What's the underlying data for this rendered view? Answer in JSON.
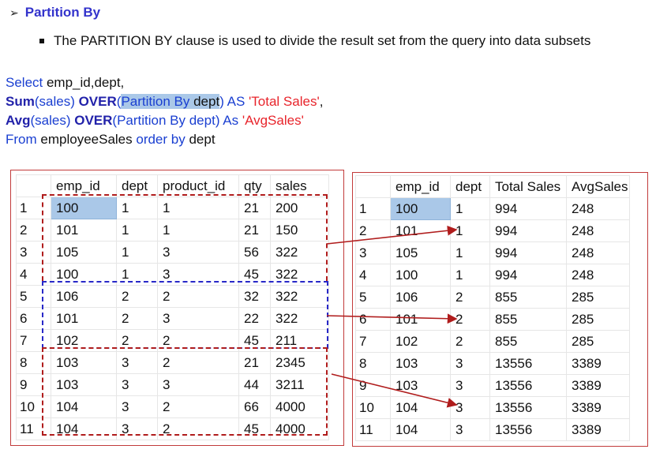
{
  "heading": {
    "arrow": "➢",
    "title": "Partition By"
  },
  "bullet": {
    "text": "The PARTITION BY clause is used to divide the result set from the query into data subsets"
  },
  "sql": {
    "line1_kw": "Select",
    "line1_rest": " emp_id,dept,",
    "line2_fn": "Sum",
    "line2_a": "(sales) ",
    "line2_over": "OVER",
    "line2_paren": "(",
    "line2_hl": "Partition By",
    "line2_dept": " dept",
    "line2_b": ") AS ",
    "line2_str": "'Total Sales'",
    "line2_c": ",",
    "line3_fn": "Avg",
    "line3_a": "(sales) ",
    "line3_over": "OVER",
    "line3_b": "(Partition By dept) As ",
    "line3_str": "'AvgSales'",
    "line4_kw": "From",
    "line4_a": " employeeSales ",
    "line4_kw2": "order by",
    "line4_b": " dept"
  },
  "left_table": {
    "headers": [
      "",
      "emp_id",
      "dept",
      "product_id",
      "qty",
      "sales"
    ],
    "rows": [
      [
        "1",
        "100",
        "1",
        "1",
        "21",
        "200"
      ],
      [
        "2",
        "101",
        "1",
        "1",
        "21",
        "150"
      ],
      [
        "3",
        "105",
        "1",
        "3",
        "56",
        "322"
      ],
      [
        "4",
        "100",
        "1",
        "3",
        "45",
        "322"
      ],
      [
        "5",
        "106",
        "2",
        "2",
        "32",
        "322"
      ],
      [
        "6",
        "101",
        "2",
        "3",
        "22",
        "322"
      ],
      [
        "7",
        "102",
        "2",
        "2",
        "45",
        "211"
      ],
      [
        "8",
        "103",
        "3",
        "2",
        "21",
        "2345"
      ],
      [
        "9",
        "103",
        "3",
        "3",
        "44",
        "3211"
      ],
      [
        "10",
        "104",
        "3",
        "2",
        "66",
        "4000"
      ],
      [
        "11",
        "104",
        "3",
        "2",
        "45",
        "4000"
      ]
    ]
  },
  "right_table": {
    "headers": [
      "",
      "emp_id",
      "dept",
      "Total Sales",
      "AvgSales"
    ],
    "rows": [
      [
        "1",
        "100",
        "1",
        "994",
        "248"
      ],
      [
        "2",
        "101",
        "1",
        "994",
        "248"
      ],
      [
        "3",
        "105",
        "1",
        "994",
        "248"
      ],
      [
        "4",
        "100",
        "1",
        "994",
        "248"
      ],
      [
        "5",
        "106",
        "2",
        "855",
        "285"
      ],
      [
        "6",
        "101",
        "2",
        "855",
        "285"
      ],
      [
        "7",
        "102",
        "2",
        "855",
        "285"
      ],
      [
        "8",
        "103",
        "3",
        "13556",
        "3389"
      ],
      [
        "9",
        "103",
        "3",
        "13556",
        "3389"
      ],
      [
        "10",
        "104",
        "3",
        "13556",
        "3389"
      ],
      [
        "11",
        "104",
        "3",
        "13556",
        "3389"
      ]
    ]
  },
  "colors": {
    "heading": "#3333cc",
    "keyword": "#1a3fd1",
    "string": "#e8242b",
    "selection": "#aac8e8",
    "partition_red": "#b01c1c",
    "partition_blue": "#2828c8",
    "arrow": "#b01c1c"
  }
}
